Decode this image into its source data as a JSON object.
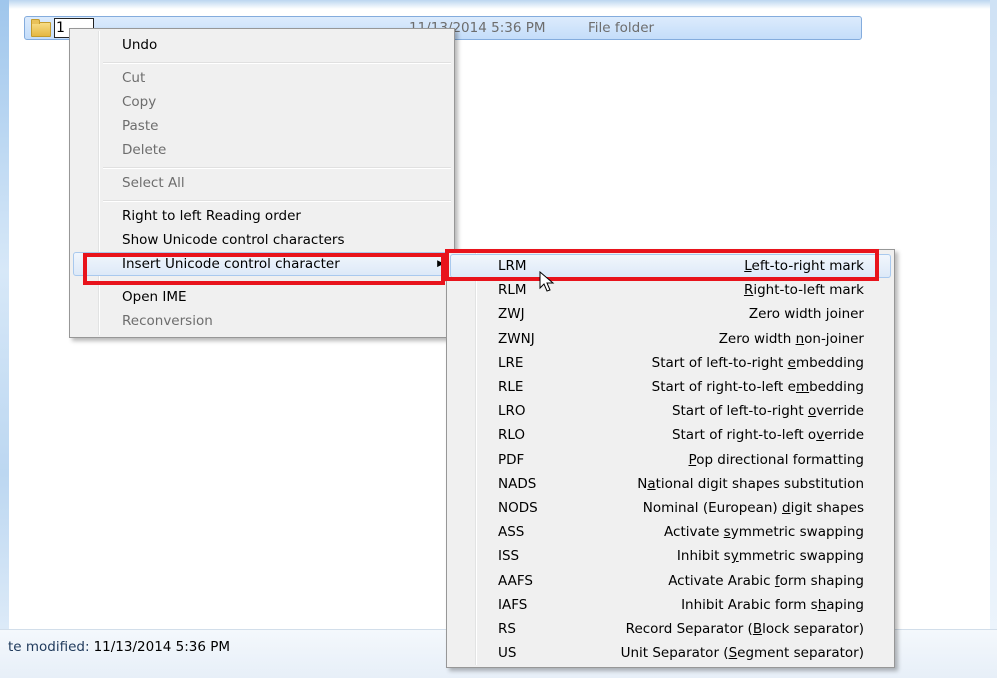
{
  "file_row": {
    "name": "1",
    "date": "11/13/2014 5:36 PM",
    "type": "File folder"
  },
  "status_bar": {
    "label": "te modified:",
    "value": "11/13/2014 5:36 PM"
  },
  "context_menu": {
    "items": [
      {
        "label": "Undo",
        "enabled": true
      },
      {
        "label": "Cut",
        "enabled": false
      },
      {
        "label": "Copy",
        "enabled": false
      },
      {
        "label": "Paste",
        "enabled": false
      },
      {
        "label": "Delete",
        "enabled": false
      },
      {
        "label": "Select All",
        "enabled": false
      },
      {
        "label": "Right to left Reading order",
        "enabled": true
      },
      {
        "label": "Show Unicode control characters",
        "enabled": true
      },
      {
        "label": "Insert Unicode control character",
        "enabled": true,
        "has_submenu": true,
        "highlighted": true
      },
      {
        "label": "Open IME",
        "enabled": true
      },
      {
        "label": "Reconversion",
        "enabled": false
      }
    ],
    "submenu_arrow": "▶"
  },
  "submenu": {
    "items": [
      {
        "code": "LRM",
        "pre": "",
        "key": "L",
        "post": "eft-to-right mark",
        "highlighted": true
      },
      {
        "code": "RLM",
        "pre": "",
        "key": "R",
        "post": "ight-to-left mark"
      },
      {
        "code": "ZWJ",
        "pre": "Zero width ",
        "key": "j",
        "post": "oiner"
      },
      {
        "code": "ZWNJ",
        "pre": "Zero width ",
        "key": "n",
        "post": "on-joiner"
      },
      {
        "code": "LRE",
        "pre": "Start of left-to-right ",
        "key": "e",
        "post": "mbedding"
      },
      {
        "code": "RLE",
        "pre": "Start of right-to-left e",
        "key": "m",
        "post": "bedding"
      },
      {
        "code": "LRO",
        "pre": "Start of left-to-right ",
        "key": "o",
        "post": "verride"
      },
      {
        "code": "RLO",
        "pre": "Start of right-to-left o",
        "key": "v",
        "post": "erride"
      },
      {
        "code": "PDF",
        "pre": "",
        "key": "P",
        "post": "op directional formatting"
      },
      {
        "code": "NADS",
        "pre": "N",
        "key": "a",
        "post": "tional digit shapes substitution"
      },
      {
        "code": "NODS",
        "pre": "Nominal (European) ",
        "key": "d",
        "post": "igit shapes"
      },
      {
        "code": "ASS",
        "pre": "Activate ",
        "key": "s",
        "post": "ymmetric swapping"
      },
      {
        "code": "ISS",
        "pre": "Inhibit s",
        "key": "y",
        "post": "mmetric swapping"
      },
      {
        "code": "AAFS",
        "pre": "Activate Arabic ",
        "key": "f",
        "post": "orm shaping"
      },
      {
        "code": "IAFS",
        "pre": "Inhibit Arabic form s",
        "key": "h",
        "post": "aping"
      },
      {
        "code": "RS",
        "pre": "Record Separator (",
        "key": "B",
        "post": "lock separator)"
      },
      {
        "code": "US",
        "pre": "Unit Separator (",
        "key": "S",
        "post": "egment separator)"
      }
    ]
  },
  "colors": {
    "annotation_red": "#e8131c",
    "highlight_border": "#a9c9ee",
    "menu_background": "#f0f0f0"
  },
  "icons": {
    "folder": "folder-icon",
    "cursor": "mouse-pointer-icon"
  }
}
